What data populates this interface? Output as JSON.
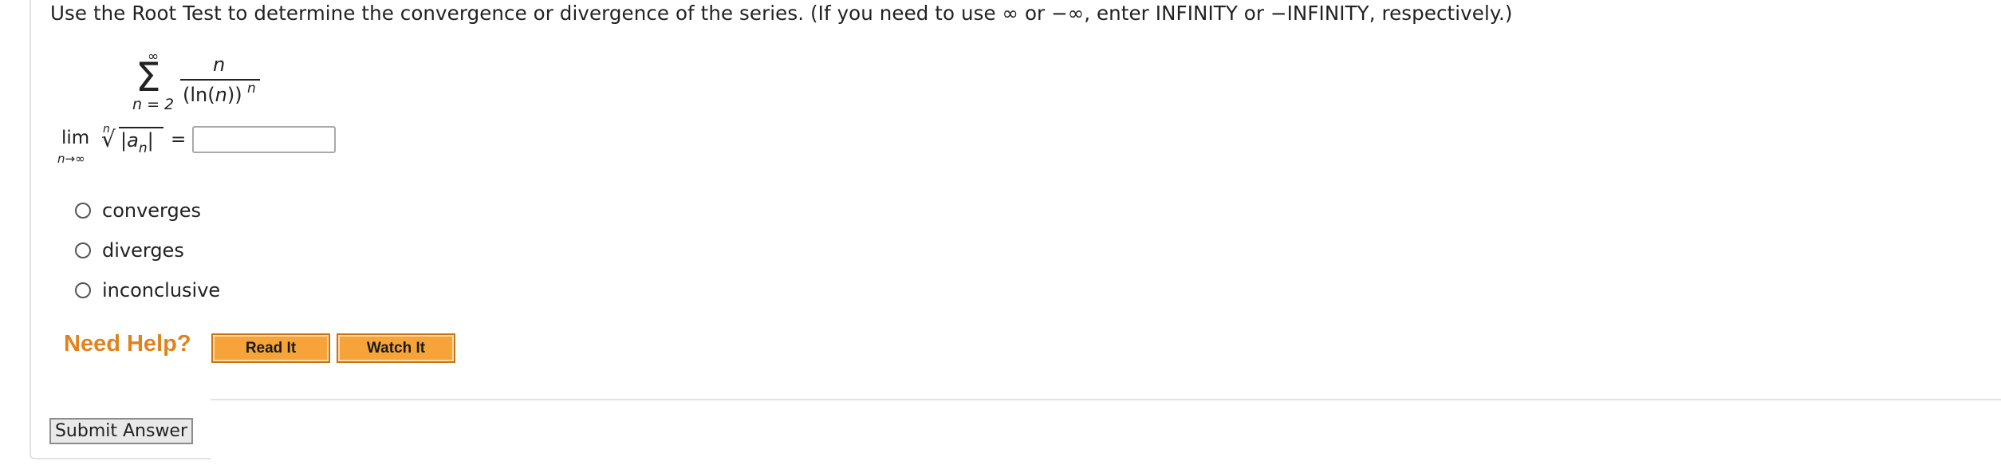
{
  "question": {
    "instruction": "Use the Root Test to determine the convergence or divergence of the series. (If you need to use ∞ or −∞, enter INFINITY or −INFINITY, respectively.)",
    "series": {
      "sigma": "Σ",
      "upper_limit": "∞",
      "lower_limit": "n = 2",
      "numerator": "n",
      "denominator_base": "(ln(",
      "denominator_var": "n",
      "denominator_close": "))",
      "denominator_exponent": "n"
    },
    "limit": {
      "lim": "lim",
      "lim_sub": "n→∞",
      "root_index": "n",
      "radical": "√",
      "abs_open": "|",
      "a": "a",
      "a_sub": "n",
      "abs_close": "|",
      "equals": "=",
      "answer_value": ""
    },
    "options": [
      {
        "label": "converges"
      },
      {
        "label": "diverges"
      },
      {
        "label": "inconclusive"
      }
    ]
  },
  "help": {
    "label": "Need Help?",
    "read_it": "Read It",
    "watch_it": "Watch It"
  },
  "submit_label": "Submit Answer",
  "colors": {
    "help_text": "#e2821c",
    "help_button": "#f6a43a",
    "help_button_border": "#c87415"
  }
}
